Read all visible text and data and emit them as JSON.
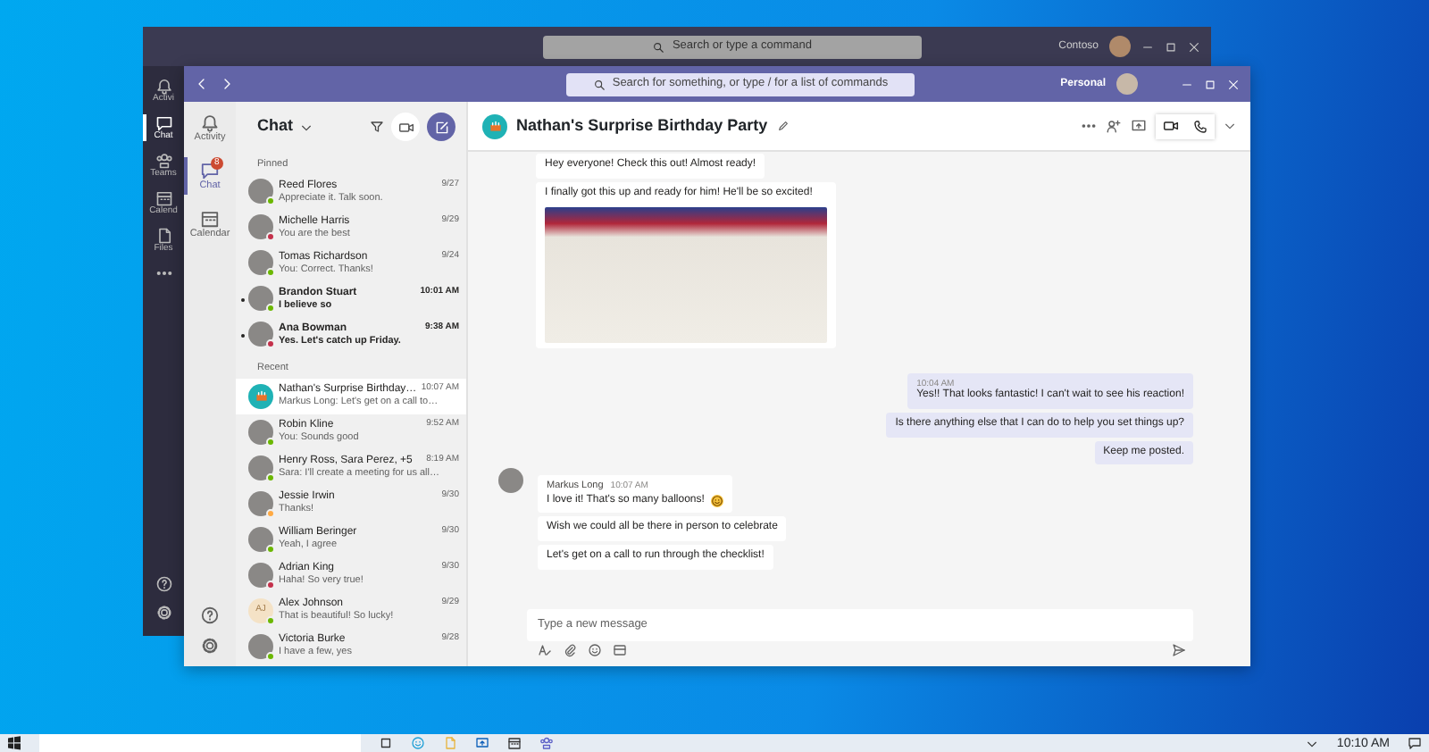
{
  "back_window": {
    "search": {
      "placeholder": "Search or type a command"
    },
    "account": "Contoso",
    "rail": [
      {
        "label": "Activi",
        "selected": false
      },
      {
        "label": "Chat",
        "selected": true
      },
      {
        "label": "Teams",
        "selected": false
      },
      {
        "label": "Calend",
        "selected": false
      },
      {
        "label": "Files",
        "selected": false
      }
    ]
  },
  "window": {
    "search": {
      "placeholder": "Search for something, or type / for a list of commands"
    },
    "account": "Personal"
  },
  "app_bar": [
    {
      "label": "Activity",
      "selected": false
    },
    {
      "label": "Chat",
      "selected": true,
      "badge": "8"
    },
    {
      "label": "Calendar",
      "selected": false
    }
  ],
  "chat_list": {
    "title": "Chat",
    "sections": [
      {
        "title": "Pinned",
        "items": [
          {
            "kind": "person",
            "name": "Reed Flores",
            "time": "9/27",
            "preview": "Appreciate it. Talk soon.",
            "color": "#6bb700",
            "unread": false,
            "selected": false
          },
          {
            "kind": "person",
            "name": "Michelle Harris",
            "time": "9/29",
            "preview": "You are the best",
            "color": "#c4314b",
            "unread": false,
            "selected": false
          },
          {
            "kind": "person",
            "name": "Tomas Richardson",
            "time": "9/24",
            "preview": "You: Correct. Thanks!",
            "color": "#6bb700",
            "unread": false,
            "selected": false
          },
          {
            "kind": "person",
            "name": "Brandon Stuart",
            "time": "10:01 AM",
            "preview": "I believe so",
            "color": "#6bb700",
            "unread": true,
            "selected": false
          },
          {
            "kind": "person",
            "name": "Ana Bowman",
            "time": "9:38 AM",
            "preview": "Yes. Let's catch up Friday.",
            "color": "#c4314b",
            "unread": true,
            "selected": false
          }
        ]
      },
      {
        "title": "Recent",
        "items": [
          {
            "kind": "group",
            "name": "Nathan's Surprise Birthday…",
            "time": "10:07 AM",
            "preview": "Markus Long: Let's get on a call to…",
            "unread": false,
            "selected": true
          },
          {
            "kind": "person",
            "name": "Robin Kline",
            "time": "9:52 AM",
            "preview": "You: Sounds good",
            "color": "#6bb700",
            "unread": false,
            "selected": false
          },
          {
            "kind": "person",
            "name": "Henry Ross, Sara Perez, +5",
            "time": "8:19 AM",
            "preview": "Sara: I'll create a meeting for us all…",
            "color": "#6bb700",
            "unread": false,
            "selected": false
          },
          {
            "kind": "person",
            "name": "Jessie Irwin",
            "time": "9/30",
            "preview": "Thanks!",
            "color": "#ffaa44",
            "unread": false,
            "selected": false
          },
          {
            "kind": "person",
            "name": "William Beringer",
            "time": "9/30",
            "preview": "Yeah, I agree",
            "color": "#6bb700",
            "unread": false,
            "selected": false
          },
          {
            "kind": "person",
            "name": "Adrian King",
            "time": "9/30",
            "preview": "Haha! So very true!",
            "color": "#c4314b",
            "unread": false,
            "selected": false
          },
          {
            "kind": "initials",
            "initials": "AJ",
            "name": "Alex Johnson",
            "time": "9/29",
            "preview": "That is beautiful! So lucky!",
            "color": "#6bb700",
            "unread": false,
            "selected": false
          },
          {
            "kind": "person",
            "name": "Victoria Burke",
            "time": "9/28",
            "preview": "I have a few, yes",
            "color": "#6bb700",
            "unread": false,
            "selected": false
          }
        ]
      }
    ]
  },
  "conversation": {
    "title": "Nathan's Surprise Birthday Party",
    "groups": [
      {
        "kind": "received",
        "bubbles": [
          {
            "text": "Hey everyone! Check this out! Almost ready!"
          },
          {
            "text": "I finally got this up and ready for him! He'll be so excited!",
            "photo": true
          }
        ]
      },
      {
        "kind": "sent",
        "time": "10:04 AM",
        "bubbles": [
          {
            "text": "Yes!! That looks fantastic! I can't wait to see his reaction!"
          },
          {
            "text": "Is there anything else that I can do to help you set things up?"
          },
          {
            "text": "Keep me posted."
          }
        ]
      },
      {
        "kind": "received",
        "author": "Markus Long",
        "time": "10:07 AM",
        "bubbles": [
          {
            "text": "I love it! That's so many balloons!",
            "emoji": true
          },
          {
            "text": "Wish we could all be there in person to celebrate"
          },
          {
            "text": "Let's get on a call to run through the checklist!"
          }
        ]
      }
    ],
    "compose": {
      "placeholder": "Type a new message"
    }
  },
  "taskbar": {
    "clock": "10:10 AM"
  }
}
